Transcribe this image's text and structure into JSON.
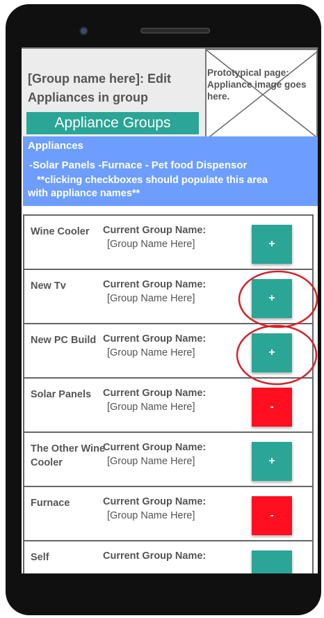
{
  "header": {
    "title": "[Group name here]: Edit Appliances in group",
    "groups_button_label": "Appliance Groups",
    "image_placeholder_text": "Prototypical page: Appliance image goes here."
  },
  "appliances_panel": {
    "title": "Appliances",
    "list_text": "-Solar Panels  -Furnace  - Pet food Dispensor",
    "note_line1": "**clicking checkboxes should populate this area",
    "note_line2": "with appliance names**"
  },
  "rows": [
    {
      "name": "Wine Cooler",
      "group_label": "Current Group Name:",
      "group_value": "[Group Name Here]",
      "action": "+",
      "action_type": "add"
    },
    {
      "name": "New Tv",
      "group_label": "Current Group Name:",
      "group_value": "[Group Name Here]",
      "action": "+",
      "action_type": "add",
      "circled": true
    },
    {
      "name": "New PC Build",
      "group_label": "Current Group Name:",
      "group_value": "[Group Name Here]",
      "action": "+",
      "action_type": "add",
      "circled": true
    },
    {
      "name": "Solar Panels",
      "group_label": "Current Group Name:",
      "group_value": "[Group Name Here]",
      "action": "-",
      "action_type": "remove"
    },
    {
      "name": "The Other Wine Cooler",
      "group_label": "Current Group Name:",
      "group_value": "[Group Name Here]",
      "action": "+",
      "action_type": "add"
    },
    {
      "name": "Furnace",
      "group_label": "Current Group Name:",
      "group_value": "[Group Name Here]",
      "action": "-",
      "action_type": "remove"
    },
    {
      "name": "Self",
      "group_label": "Current Group Name:",
      "group_value": "",
      "action": "",
      "action_type": "add"
    }
  ],
  "colors": {
    "accent_teal": "#2aa596",
    "remove_red": "#ff0f1f",
    "panel_blue": "#6d9eff",
    "annotation_red": "#d81f26"
  }
}
